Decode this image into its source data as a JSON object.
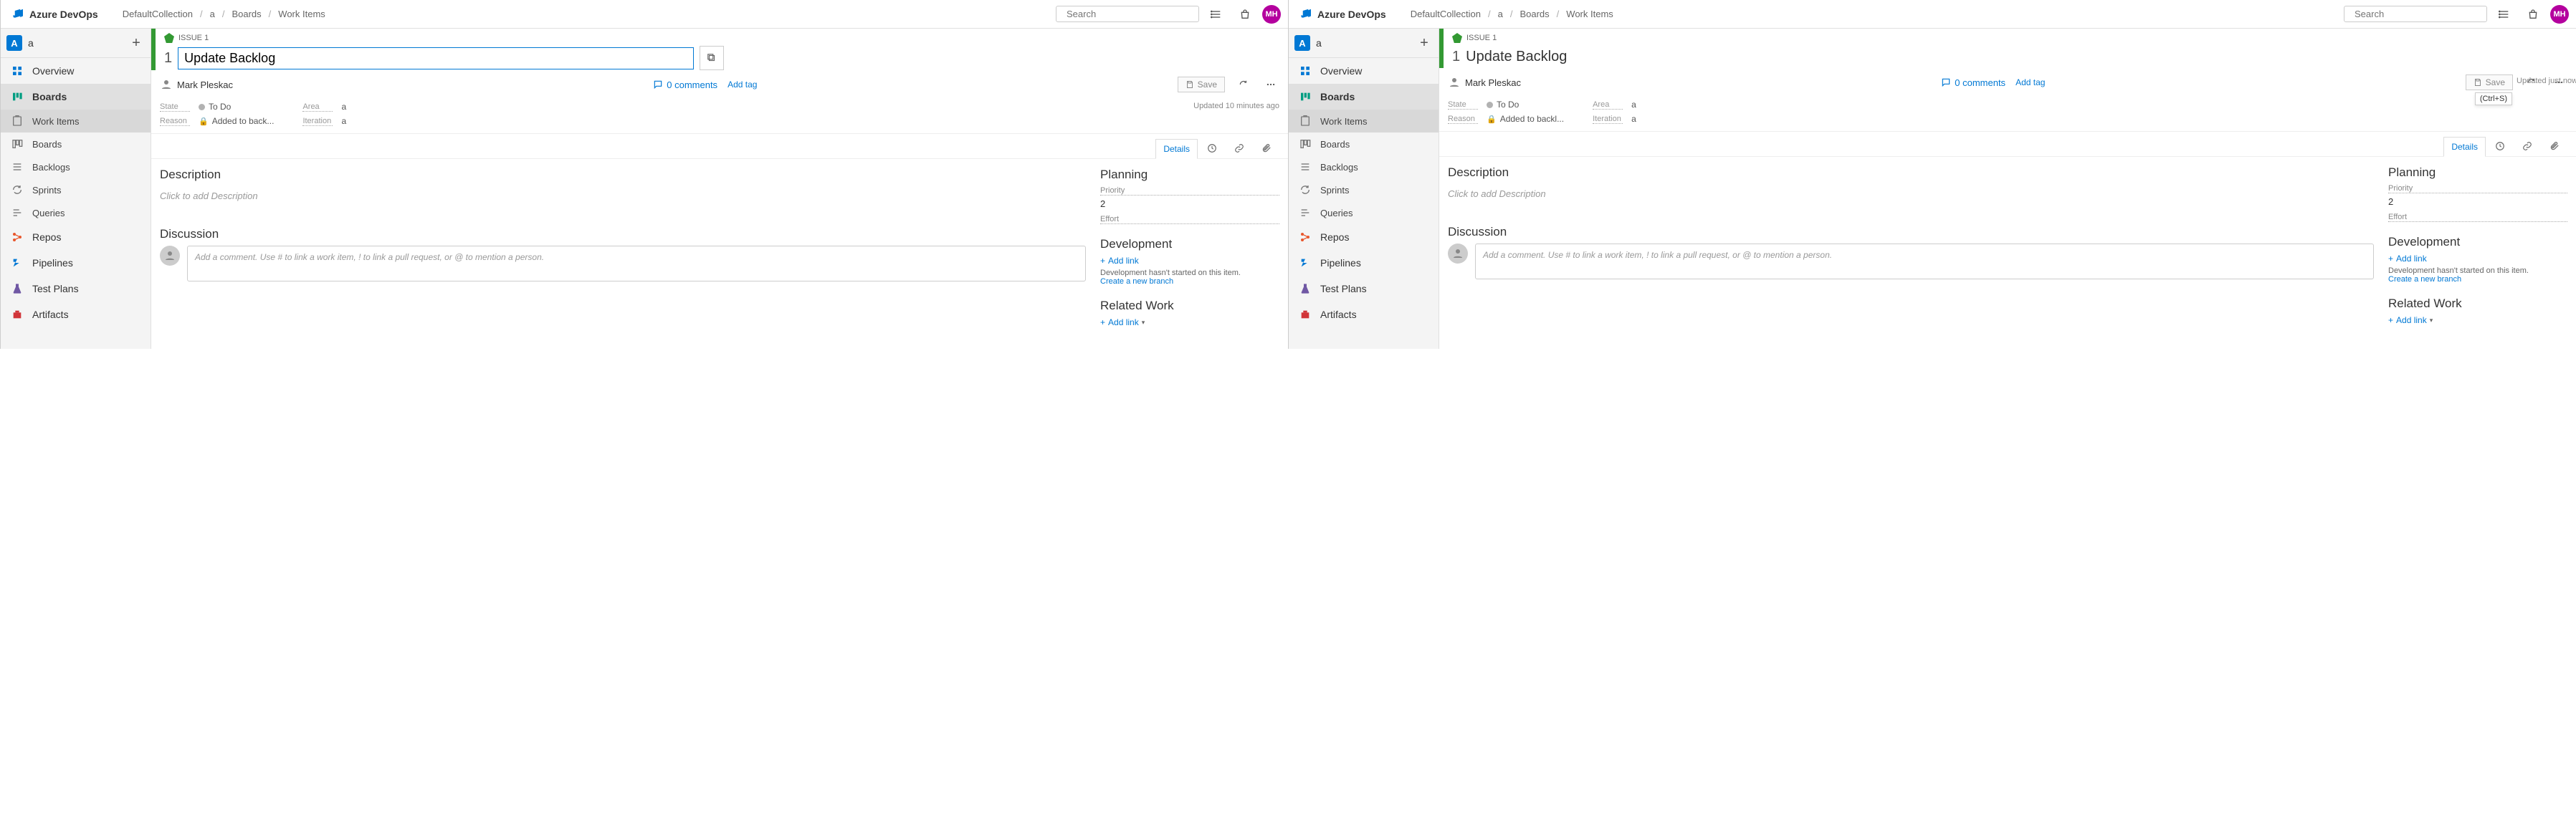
{
  "common": {
    "logo_text": "Azure DevOps",
    "breadcrumbs": [
      "DefaultCollection",
      "a",
      "Boards",
      "Work Items"
    ],
    "search_placeholder": "Search",
    "avatar_initials": "MH",
    "project_badge": "A",
    "project_name": "a",
    "nav_main": {
      "overview": "Overview",
      "boards": "Boards",
      "repos": "Repos",
      "pipelines": "Pipelines",
      "testplans": "Test Plans",
      "artifacts": "Artifacts"
    },
    "nav_sub": {
      "work_items": "Work Items",
      "boards": "Boards",
      "backlogs": "Backlogs",
      "sprints": "Sprints",
      "queries": "Queries"
    },
    "workitem": {
      "type": "ISSUE 1",
      "id": "1",
      "title": "Update Backlog",
      "assigned_to": "Mark Pleskac",
      "comments": "0 comments",
      "add_tag": "Add tag",
      "save": "Save",
      "state_label": "State",
      "state_value": "To Do",
      "reason_label": "Reason",
      "reason_value": "Added to back...",
      "reason_value_long": "Added to backl...",
      "area_label": "Area",
      "area_value": "a",
      "iteration_label": "Iteration",
      "iteration_value": "a",
      "tabs": {
        "details": "Details"
      },
      "sections": {
        "description": "Description",
        "description_ph": "Click to add Description",
        "discussion": "Discussion",
        "discussion_ph": "Add a comment. Use # to link a work item, ! to link a pull request, or @ to mention a person.",
        "planning": "Planning",
        "priority_lbl": "Priority",
        "priority_val": "2",
        "effort_lbl": "Effort",
        "development": "Development",
        "add_link": "Add link",
        "dev_msg": "Development hasn't started on this item.",
        "dev_branch": "Create a new branch",
        "related": "Related Work"
      }
    }
  },
  "left": {
    "updated": "Updated 10 minutes ago"
  },
  "right": {
    "updated": "Updated just now",
    "save_tooltip": "(Ctrl+S)"
  }
}
